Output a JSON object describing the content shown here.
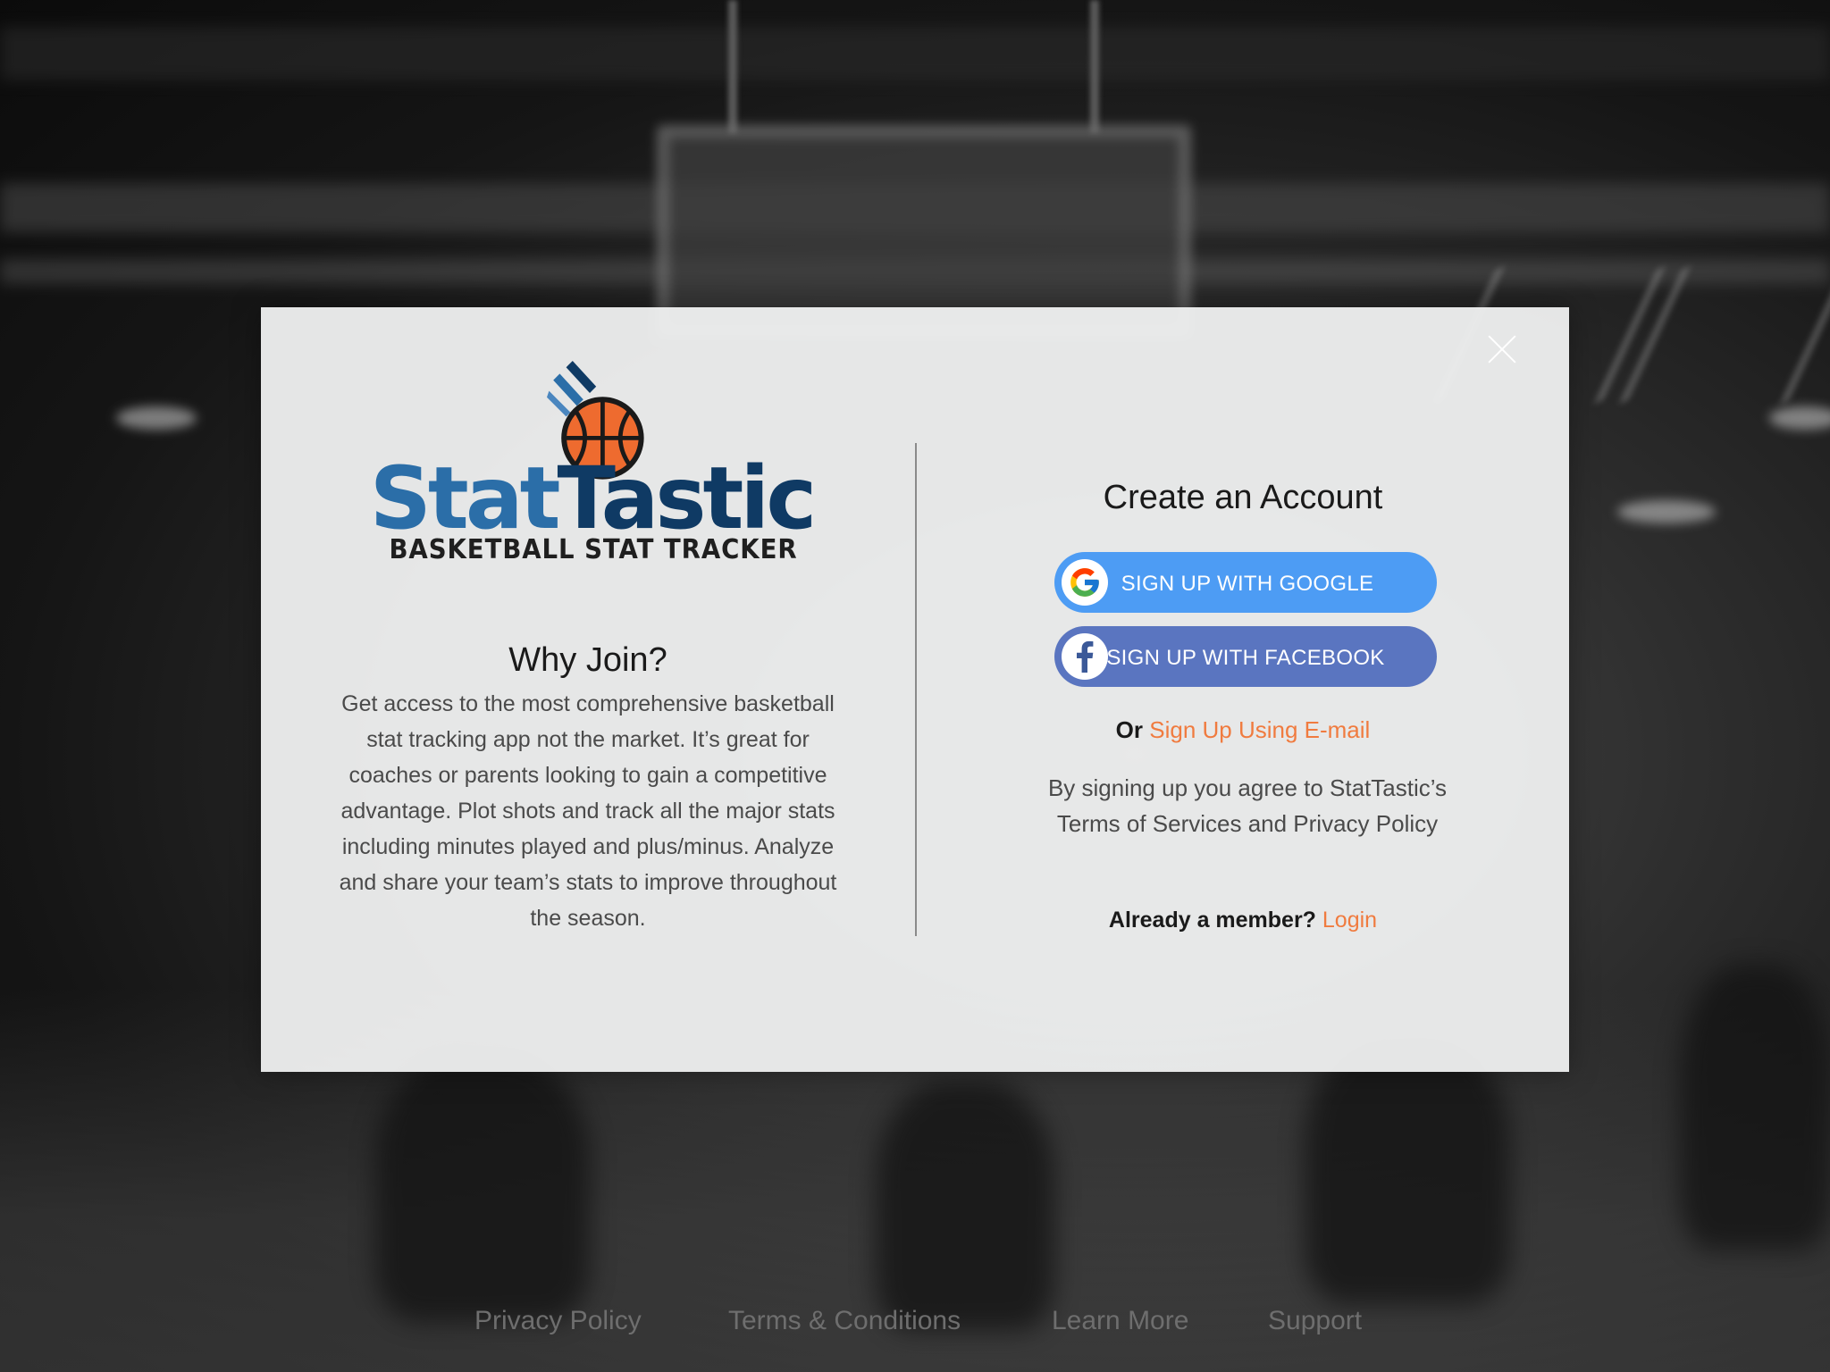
{
  "modal": {
    "brand": {
      "name_part1": "Stat",
      "name_part2": "Tastic",
      "tagline": "BASKETBALL STAT TRACKER"
    },
    "why_join": {
      "title": "Why Join?",
      "text": "Get access to the most comprehensive basketball stat tracking app not the market. It’s great for coaches or parents looking to gain a competitive advantage. Plot shots and track all the major stats including minutes played and plus/minus. Analyze and share your team’s stats to improve throughout the season."
    },
    "signup": {
      "title": "Create an Account",
      "google_label": "SIGN UP WITH GOOGLE",
      "facebook_label": "SIGN UP WITH FACEBOOK",
      "or_label": "Or",
      "email_link": "Sign Up Using E-mail",
      "terms_text": "By signing up you agree to StatTastic’s Terms of Services and Privacy Policy",
      "member_question": "Already a member?",
      "login_link": "Login"
    }
  },
  "footer": {
    "links": [
      "Privacy Policy",
      "Terms & Conditions",
      "Learn More",
      "Support"
    ]
  },
  "colors": {
    "google_button": "#4d9cf4",
    "facebook_button": "#5a75c0",
    "accent_link": "#f07b3f",
    "brand_light_blue": "#2b6ea8",
    "brand_dark_blue": "#0f3a64",
    "ball_orange": "#ee6b2f"
  },
  "icons": [
    "basketball-logo-icon",
    "close-icon",
    "google-icon",
    "facebook-icon"
  ]
}
